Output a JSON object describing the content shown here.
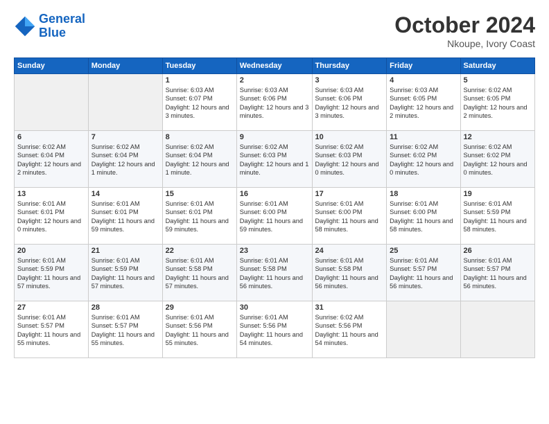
{
  "header": {
    "logo_line1": "General",
    "logo_line2": "Blue",
    "month": "October 2024",
    "location": "Nkoupe, Ivory Coast"
  },
  "weekdays": [
    "Sunday",
    "Monday",
    "Tuesday",
    "Wednesday",
    "Thursday",
    "Friday",
    "Saturday"
  ],
  "weeks": [
    [
      {
        "day": "",
        "info": ""
      },
      {
        "day": "",
        "info": ""
      },
      {
        "day": "1",
        "info": "Sunrise: 6:03 AM\nSunset: 6:07 PM\nDaylight: 12 hours and 3 minutes."
      },
      {
        "day": "2",
        "info": "Sunrise: 6:03 AM\nSunset: 6:06 PM\nDaylight: 12 hours and 3 minutes."
      },
      {
        "day": "3",
        "info": "Sunrise: 6:03 AM\nSunset: 6:06 PM\nDaylight: 12 hours and 3 minutes."
      },
      {
        "day": "4",
        "info": "Sunrise: 6:03 AM\nSunset: 6:05 PM\nDaylight: 12 hours and 2 minutes."
      },
      {
        "day": "5",
        "info": "Sunrise: 6:02 AM\nSunset: 6:05 PM\nDaylight: 12 hours and 2 minutes."
      }
    ],
    [
      {
        "day": "6",
        "info": "Sunrise: 6:02 AM\nSunset: 6:04 PM\nDaylight: 12 hours and 2 minutes."
      },
      {
        "day": "7",
        "info": "Sunrise: 6:02 AM\nSunset: 6:04 PM\nDaylight: 12 hours and 1 minute."
      },
      {
        "day": "8",
        "info": "Sunrise: 6:02 AM\nSunset: 6:04 PM\nDaylight: 12 hours and 1 minute."
      },
      {
        "day": "9",
        "info": "Sunrise: 6:02 AM\nSunset: 6:03 PM\nDaylight: 12 hours and 1 minute."
      },
      {
        "day": "10",
        "info": "Sunrise: 6:02 AM\nSunset: 6:03 PM\nDaylight: 12 hours and 0 minutes."
      },
      {
        "day": "11",
        "info": "Sunrise: 6:02 AM\nSunset: 6:02 PM\nDaylight: 12 hours and 0 minutes."
      },
      {
        "day": "12",
        "info": "Sunrise: 6:02 AM\nSunset: 6:02 PM\nDaylight: 12 hours and 0 minutes."
      }
    ],
    [
      {
        "day": "13",
        "info": "Sunrise: 6:01 AM\nSunset: 6:01 PM\nDaylight: 12 hours and 0 minutes."
      },
      {
        "day": "14",
        "info": "Sunrise: 6:01 AM\nSunset: 6:01 PM\nDaylight: 11 hours and 59 minutes."
      },
      {
        "day": "15",
        "info": "Sunrise: 6:01 AM\nSunset: 6:01 PM\nDaylight: 11 hours and 59 minutes."
      },
      {
        "day": "16",
        "info": "Sunrise: 6:01 AM\nSunset: 6:00 PM\nDaylight: 11 hours and 59 minutes."
      },
      {
        "day": "17",
        "info": "Sunrise: 6:01 AM\nSunset: 6:00 PM\nDaylight: 11 hours and 58 minutes."
      },
      {
        "day": "18",
        "info": "Sunrise: 6:01 AM\nSunset: 6:00 PM\nDaylight: 11 hours and 58 minutes."
      },
      {
        "day": "19",
        "info": "Sunrise: 6:01 AM\nSunset: 5:59 PM\nDaylight: 11 hours and 58 minutes."
      }
    ],
    [
      {
        "day": "20",
        "info": "Sunrise: 6:01 AM\nSunset: 5:59 PM\nDaylight: 11 hours and 57 minutes."
      },
      {
        "day": "21",
        "info": "Sunrise: 6:01 AM\nSunset: 5:59 PM\nDaylight: 11 hours and 57 minutes."
      },
      {
        "day": "22",
        "info": "Sunrise: 6:01 AM\nSunset: 5:58 PM\nDaylight: 11 hours and 57 minutes."
      },
      {
        "day": "23",
        "info": "Sunrise: 6:01 AM\nSunset: 5:58 PM\nDaylight: 11 hours and 56 minutes."
      },
      {
        "day": "24",
        "info": "Sunrise: 6:01 AM\nSunset: 5:58 PM\nDaylight: 11 hours and 56 minutes."
      },
      {
        "day": "25",
        "info": "Sunrise: 6:01 AM\nSunset: 5:57 PM\nDaylight: 11 hours and 56 minutes."
      },
      {
        "day": "26",
        "info": "Sunrise: 6:01 AM\nSunset: 5:57 PM\nDaylight: 11 hours and 56 minutes."
      }
    ],
    [
      {
        "day": "27",
        "info": "Sunrise: 6:01 AM\nSunset: 5:57 PM\nDaylight: 11 hours and 55 minutes."
      },
      {
        "day": "28",
        "info": "Sunrise: 6:01 AM\nSunset: 5:57 PM\nDaylight: 11 hours and 55 minutes."
      },
      {
        "day": "29",
        "info": "Sunrise: 6:01 AM\nSunset: 5:56 PM\nDaylight: 11 hours and 55 minutes."
      },
      {
        "day": "30",
        "info": "Sunrise: 6:01 AM\nSunset: 5:56 PM\nDaylight: 11 hours and 54 minutes."
      },
      {
        "day": "31",
        "info": "Sunrise: 6:02 AM\nSunset: 5:56 PM\nDaylight: 11 hours and 54 minutes."
      },
      {
        "day": "",
        "info": ""
      },
      {
        "day": "",
        "info": ""
      }
    ]
  ]
}
